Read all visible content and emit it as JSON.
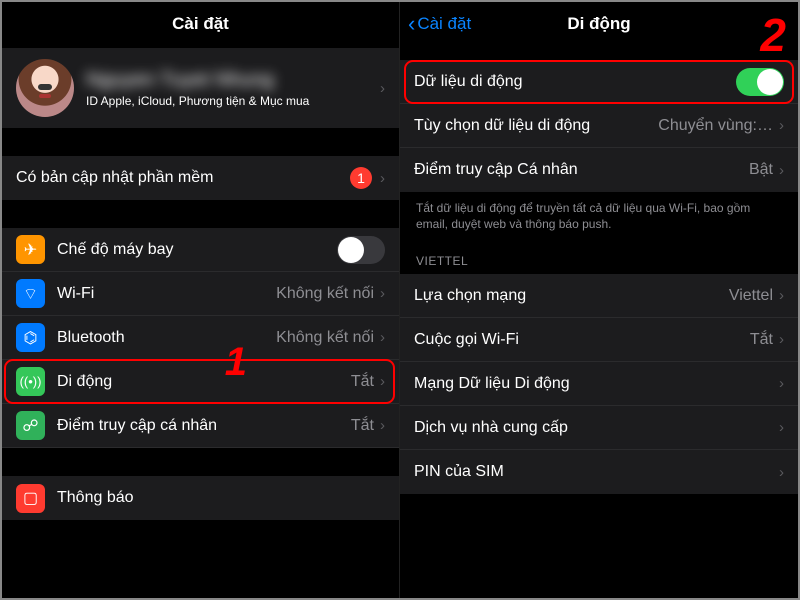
{
  "left": {
    "title": "Cài đặt",
    "profile": {
      "name": "Nguyen Tuyet Nhung",
      "sub": "ID Apple, iCloud, Phương tiện & Mục mua"
    },
    "update": {
      "label": "Có bản cập nhật phần mềm",
      "badge": "1"
    },
    "rows": {
      "airplane": "Chế độ máy bay",
      "wifi": "Wi-Fi",
      "wifi_val": "Không kết nối",
      "bt": "Bluetooth",
      "bt_val": "Không kết nối",
      "cellular": "Di động",
      "cellular_val": "Tắt",
      "hotspot": "Điểm truy cập cá nhân",
      "hotspot_val": "Tắt",
      "notify": "Thông báo"
    },
    "step": "1"
  },
  "right": {
    "back": "Cài đặt",
    "title": "Di động",
    "rows": {
      "data": "Dữ liệu di động",
      "options": "Tùy chọn dữ liệu di động",
      "options_val": "Chuyển vùng:…",
      "hotspot": "Điểm truy cập Cá nhân",
      "hotspot_val": "Bật"
    },
    "note": "Tắt dữ liệu di động để truyền tất cả dữ liệu qua Wi-Fi, bao gồm email, duyệt web và thông báo push.",
    "carrier_header": "VIETTEL",
    "carrier": {
      "network": "Lựa chọn mạng",
      "network_val": "Viettel",
      "wificall": "Cuộc gọi Wi-Fi",
      "wificall_val": "Tắt",
      "datanet": "Mạng Dữ liệu Di động",
      "services": "Dịch vụ nhà cung cấp",
      "simpin": "PIN của SIM"
    },
    "step": "2"
  }
}
